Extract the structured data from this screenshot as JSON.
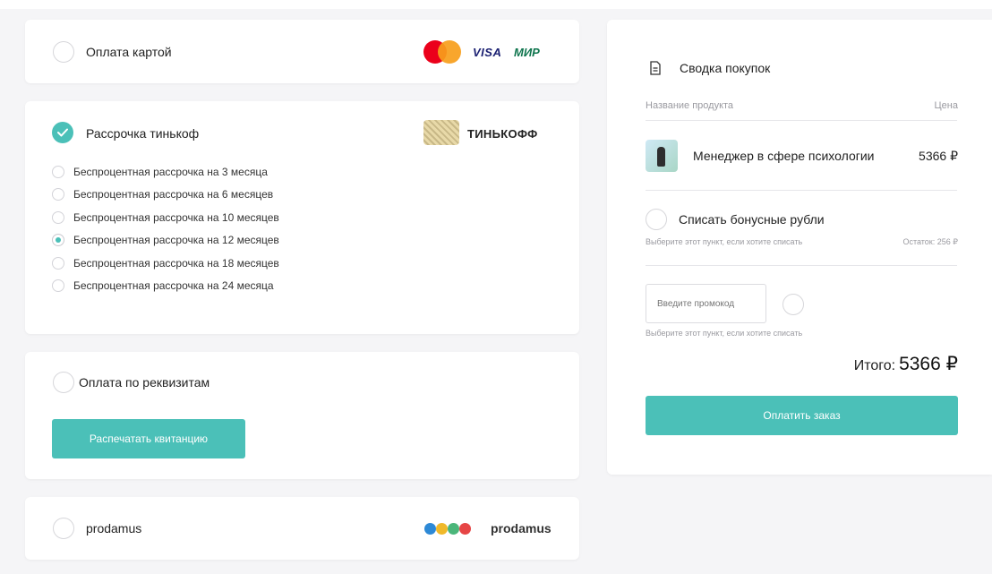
{
  "payment_methods": {
    "card": {
      "title": "Оплата картой",
      "logos": {
        "visa": "VISA",
        "mir": "МИР"
      }
    },
    "tinkoff": {
      "title": "Рассрочка тинькоф",
      "logo_text": "ТИНЬКОФФ",
      "plans": [
        {
          "label": "Беспроцентная рассрочка на 3 месяца",
          "selected": false
        },
        {
          "label": "Беспроцентная рассрочка на 6 месяцев",
          "selected": false
        },
        {
          "label": "Беспроцентная рассрочка на 10 месяцев",
          "selected": false
        },
        {
          "label": "Беспроцентная рассрочка на 12 месяцев",
          "selected": true
        },
        {
          "label": "Беспроцентная рассрочка на 18 месяцев",
          "selected": false
        },
        {
          "label": "Беспроцентная рассрочка на 24 месяца",
          "selected": false
        }
      ]
    },
    "requisites": {
      "title": "Оплата по реквизитам",
      "print_button": "Распечатать квитанцию"
    },
    "prodamus": {
      "title": "prodamus",
      "logo_text": "prodamus"
    }
  },
  "summary": {
    "title": "Сводка покупок",
    "header_product": "Название продукта",
    "header_price": "Цена",
    "product_name": "Менеджер в сфере психологии",
    "product_price": "5366 ₽",
    "bonus_label": "Списать бонусные рубли",
    "bonus_hint": "Выберите этот пункт, если хотите списать",
    "bonus_balance": "Остаток: 256 ₽",
    "promo_placeholder": "Введите промокод",
    "promo_hint": "Выберите этот пункт, если хотите списать",
    "total_label": "Итого:",
    "total_value": "5366 ₽",
    "pay_button": "Оплатить заказ"
  },
  "colors": {
    "accent": "#4bc0b8",
    "mastercard_red": "#eb001b",
    "mastercard_yellow": "#f79e1b",
    "visa_blue": "#1a1f71",
    "mir_green": "#0f754e"
  }
}
